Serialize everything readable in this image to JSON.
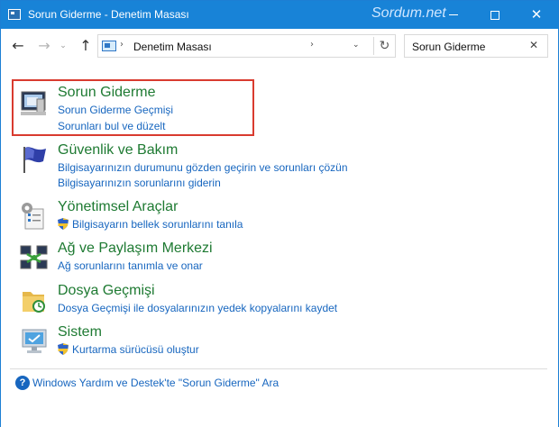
{
  "window": {
    "title": "Sorun Giderme - Denetim Masası",
    "watermark": "Sordum.net",
    "controls": {
      "minimize": "minimize-icon",
      "maximize": "maximize-icon",
      "close": "✕"
    }
  },
  "address": {
    "path": "Denetim Masası",
    "search_value": "Sorun Giderme",
    "icons": [
      "back-arrow-icon",
      "forward-arrow-icon",
      "recent-chevron-icon",
      "up-arrow-icon",
      "refresh-icon",
      "clear-icon"
    ],
    "glyphs": {
      "back": "←",
      "forward": "→",
      "recent": "⌄",
      "up": "↑",
      "sep": "›",
      "dropdown": "⌄",
      "refresh": "↻",
      "clear": "✕"
    }
  },
  "results": [
    {
      "title": "Sorun Giderme",
      "links": [
        "Sorun Giderme Geçmişi",
        "Sorunları bul ve düzelt"
      ],
      "icon": "troubleshooting-icon",
      "highlighted": true
    },
    {
      "title": "Güvenlik ve Bakım",
      "links": [
        "Bilgisayarınızın durumunu gözden geçirin ve sorunları çözün",
        "Bilgisayarınızın sorunlarını giderin"
      ],
      "icon": "security-flag-icon"
    },
    {
      "title": "Yönetimsel Araçlar",
      "links": [
        "Bilgisayarın bellek sorunlarını tanıla"
      ],
      "icon": "admin-tools-icon",
      "shield": true
    },
    {
      "title": "Ağ ve Paylaşım Merkezi",
      "links": [
        "Ağ sorunlarını tanımla ve onar"
      ],
      "icon": "network-icon"
    },
    {
      "title": "Dosya Geçmişi",
      "links": [
        "Dosya Geçmişi ile dosyalarınızın yedek kopyalarını kaydet"
      ],
      "icon": "file-history-icon"
    },
    {
      "title": "Sistem",
      "links": [
        "Kurtarma sürücüsü oluştur"
      ],
      "icon": "system-monitor-icon",
      "shield": true
    }
  ],
  "help": {
    "link": "Windows Yardım ve Destek'te \"Sorun Giderme\" Ara",
    "icon_glyph": "?"
  },
  "colors": {
    "titlebar": "#1883d7",
    "title_green": "#1e7a32",
    "link_blue": "#1766bf",
    "highlight_red": "#d93b2f"
  }
}
